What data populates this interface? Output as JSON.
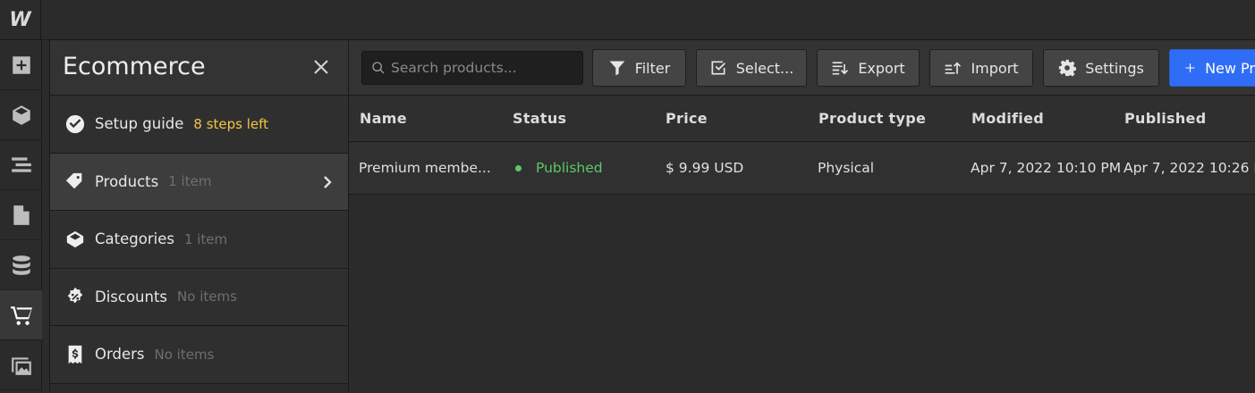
{
  "app": {
    "logo": "W"
  },
  "panel": {
    "title": "Ecommerce",
    "items": [
      {
        "label": "Setup guide",
        "meta": "8 steps left",
        "icon": "check-circle-icon"
      },
      {
        "label": "Products",
        "meta": "1 item",
        "icon": "tag-icon",
        "active": true
      },
      {
        "label": "Categories",
        "meta": "1 item",
        "icon": "box-icon"
      },
      {
        "label": "Discounts",
        "meta": "No items",
        "icon": "discount-badge-icon"
      },
      {
        "label": "Orders",
        "meta": "No items",
        "icon": "receipt-icon"
      }
    ]
  },
  "toolbar": {
    "search_placeholder": "Search products...",
    "filter_label": "Filter",
    "select_label": "Select...",
    "export_label": "Export",
    "import_label": "Import",
    "settings_label": "Settings",
    "new_label": "New Pr"
  },
  "table": {
    "headers": [
      "Name",
      "Status",
      "Price",
      "Product type",
      "Modified",
      "Published"
    ],
    "rows": [
      [
        "Premium membe...",
        "Published",
        "$ 9.99 USD",
        "Physical",
        "Apr 7, 2022 10:10 PM",
        "Apr 7, 2022 10:26 P"
      ]
    ]
  },
  "colors": {
    "accent": "#2f6df6",
    "published": "#5ec76a",
    "warning": "#f5c542"
  }
}
